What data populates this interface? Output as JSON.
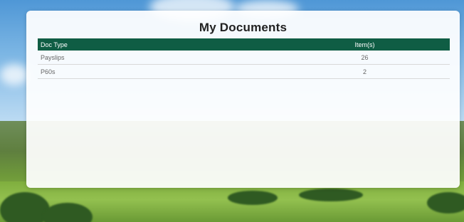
{
  "page": {
    "title": "My Documents"
  },
  "table": {
    "headers": {
      "doc_type": "Doc Type",
      "items": "Item(s)"
    },
    "rows": [
      {
        "doc_type": "Payslips",
        "items": "26"
      },
      {
        "doc_type": "P60s",
        "items": "2"
      }
    ]
  },
  "colors": {
    "header_bg": "#0f5d44",
    "header_text": "#ffffff",
    "card_bg": "rgba(255,255,255,0.93)"
  }
}
